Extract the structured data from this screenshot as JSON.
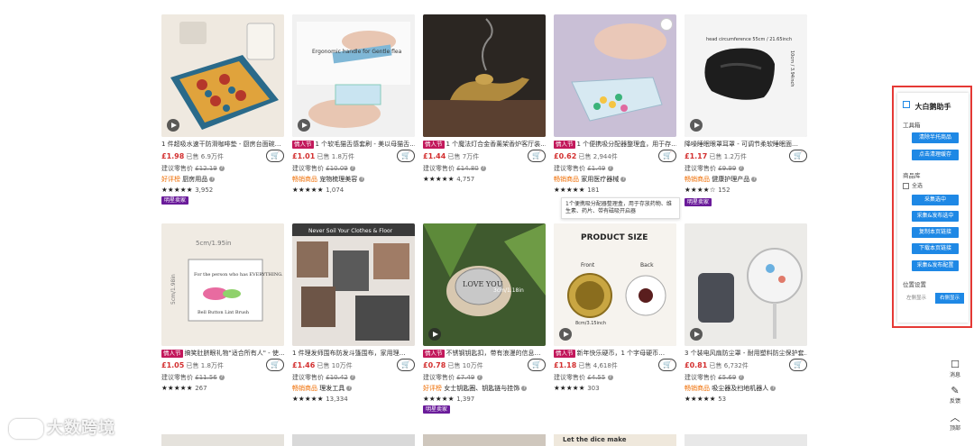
{
  "products": [
    {
      "title": "1 件超吸水速干防滑咖啡垫 - 厨房台面碗…",
      "tag": "",
      "price": "£1.98",
      "sold": "已售 6.9万件",
      "rrp_label": "建议零售价",
      "rrp": "£12.19",
      "category_prefix": "好评榜",
      "category": "厨房用品",
      "stars": "★★★★★",
      "reviews": "3,952",
      "badge": "明星卖家"
    },
    {
      "title": "1 个软毛猫舌感套刷 - 美以母猫舌…",
      "tag": "情人节",
      "price": "£1.01",
      "sold": "已售 1.8万件",
      "rrp_label": "建议零售价",
      "rrp": "£10.09",
      "category_prefix": "畅销商品",
      "category": "宠物梳理美容",
      "stars": "★★★★★",
      "reviews": "1,074",
      "badge": ""
    },
    {
      "title": "1 个魔法灯合金香薰架香炉客厅装…",
      "tag": "情人节",
      "price": "£1.44",
      "sold": "已售 7万件",
      "rrp_label": "建议零售价",
      "rrp": "£14.80",
      "category_prefix": "",
      "category": "",
      "stars": "★★★★★",
      "reviews": "4,757",
      "badge": ""
    },
    {
      "title": "1 个便携吸分配器整理盒，用于存…",
      "tag": "情人节",
      "price": "£0.62",
      "sold": "已售 2,944件",
      "rrp_label": "建议零售价",
      "rrp": "£1.49",
      "category_prefix": "畅销商品",
      "category": "家用医疗器械",
      "stars": "★★★★★",
      "reviews": "181",
      "badge": ""
    },
    {
      "title": "降噪睡眠眼罩耳罩 - 可调节柔软睡眠面…",
      "tag": "",
      "price": "£1.17",
      "sold": "已售 1.2万件",
      "rrp_label": "建议零售价",
      "rrp": "£9.99",
      "category_prefix": "畅销商品",
      "category": "健康护理产品",
      "stars": "★★★★☆",
      "reviews": "152",
      "badge": "明星卖家"
    },
    {
      "title": "搞笑肚脐眼礼物\"适合所有人\" - 使…",
      "tag": "情人节",
      "price": "£1.05",
      "sold": "已售 1.8万件",
      "rrp_label": "建议零售价",
      "rrp": "£11.56",
      "category_prefix": "",
      "category": "",
      "stars": "★★★★★",
      "reviews": "267",
      "badge": ""
    },
    {
      "title": "1 件理发师围布防发斗篷围布，家用理…",
      "tag": "",
      "price": "£1.46",
      "sold": "已售 10万件",
      "rrp_label": "建议零售价",
      "rrp": "£10.42",
      "category_prefix": "畅销商品",
      "category": "理发工具",
      "stars": "★★★★★",
      "reviews": "13,334",
      "badge": ""
    },
    {
      "title": "不锈钢钥匙扣，带有浪漫的信息…",
      "tag": "情人节",
      "price": "£0.78",
      "sold": "已售 10万件",
      "rrp_label": "建议零售价",
      "rrp": "£7.49",
      "category_prefix": "好评榜",
      "category": "女士钥匙圈、钥匙链与挂饰",
      "stars": "★★★★★",
      "reviews": "1,397",
      "badge": "明星卖家"
    },
    {
      "title": "新年快乐硬币，1 个字母硬币…",
      "tag": "情人节",
      "price": "£1.18",
      "sold": "已售 4,618件",
      "rrp_label": "建议零售价",
      "rrp": "£4.55",
      "category_prefix": "",
      "category": "",
      "stars": "★★★★★",
      "reviews": "303",
      "badge": ""
    },
    {
      "title": "3 个装电风扇防尘罩 - 耐用塑料防尘保护套…",
      "tag": "",
      "price": "£0.81",
      "sold": "已售 6,732件",
      "rrp_label": "建议零售价",
      "rrp": "£5.69",
      "category_prefix": "畅销商品",
      "category": "吸尘器及扫地机器人",
      "stars": "★★★★★",
      "reviews": "53",
      "badge": ""
    }
  ],
  "image_text": {
    "p2": "Ergonomic handle for Gentle flea",
    "p5": "head circumference 55cm / 21.65inch",
    "p5b": "10cm / 3.94inch",
    "p6a": "5cm/1.95in",
    "p6b": "5cm/1.98in",
    "p6c": "For the person who has EVERYTHING.",
    "p6d": "Bell Button Lint Brush",
    "p7": "Never Soil Your Clothes & Floor",
    "p8a": "LOVE YOU",
    "p8b": "3cm/1.18in",
    "p9a": "PRODUCT SIZE",
    "p9b": "Front",
    "p9c": "Back",
    "p9d": "8cm/3.15inch",
    "bottom4": "Let the dice make"
  },
  "tooltip": "1个便携吸分配器整理盒，用于存放药物、维生素、药片、带有磁吸开启器",
  "cart_icon": "cart-plus-icon",
  "panel": {
    "title": "大白鹅助手",
    "tools_label": "工具箱",
    "btn_clear": "清除半托商品",
    "btn_cache": "点击清理缓存",
    "library_label": "商品库",
    "select_all": "全选",
    "btn_collect": "采集选中",
    "btn_collect_publish": "采集&发布选中",
    "btn_copy_links": "复制本页链接",
    "btn_download_links": "下载本页链接",
    "btn_collect_config": "采集&发布配置",
    "position_label": "位置设置",
    "pos_left": "左侧显示",
    "pos_right": "右侧显示",
    "accent": "#1e88e5",
    "border": "#e53935"
  },
  "side": {
    "messages": "消息",
    "feedback": "反馈",
    "top": "顶部"
  },
  "watermark": "大数跨境",
  "colors": {
    "price": "#d32f2f",
    "tag": "#c2185b",
    "badge": "#6a1b9a",
    "category": "#ef6c00"
  }
}
